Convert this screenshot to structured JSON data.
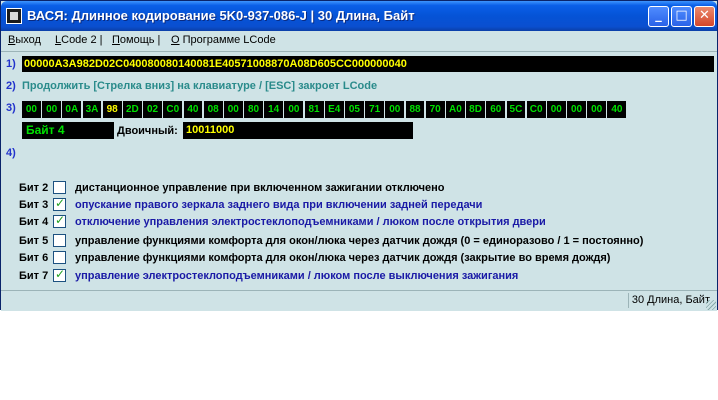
{
  "window": {
    "title": "ВАСЯ: Длинное кодирование  5K0-937-086-J  |  30 Длина, Байт",
    "minimize": "_",
    "maximize": "□",
    "close": "✕"
  },
  "menu": [
    {
      "label": "Выход"
    },
    {
      "label": "LCode 2 |"
    },
    {
      "label": "Помощь |"
    },
    {
      "label": "О Программе LCode"
    }
  ],
  "rows": {
    "r1": "1)",
    "r2": "2)",
    "r3": "3)",
    "r4": "4)"
  },
  "coding_string": "00000A3A982D02C040080080140081E40571008870A08D605CC000000040",
  "hint": "Продолжить [Стрелка вниз] на клавиатуре / [ESC] закроет LCode",
  "bytes": [
    "00",
    "00",
    "0A",
    "3A",
    "98",
    "2D",
    "02",
    "C0",
    "40",
    "08",
    "00",
    "80",
    "14",
    "00",
    "81",
    "E4",
    "05",
    "71",
    "00",
    "88",
    "70",
    "A0",
    "8D",
    "60",
    "5C",
    "C0",
    "00",
    "00",
    "00",
    "40"
  ],
  "selected_byte_index": 4,
  "byte_label": "Байт 4",
  "binary_label": "Двоичный:",
  "binary_value": "10011000",
  "bits": [
    {
      "label": "Бит 2",
      "checked": false,
      "desc": "дистанционное управление при включенном зажигании отключено"
    },
    {
      "label": "Бит 3",
      "checked": true,
      "desc": "опускание правого зеркала заднего вида при включении задней передачи"
    },
    {
      "label": "Бит 4",
      "checked": true,
      "desc": "отключение управления электростеклоподъемниками / люком после открытия двери"
    },
    {
      "label": "Бит 5",
      "checked": false,
      "desc": "управление функциями комфорта для окон/люка через датчик дождя (0 = единоразово / 1 = постоянно)"
    },
    {
      "label": "Бит 6",
      "checked": false,
      "desc": "управление функциями комфорта для окон/люка через датчик дождя (закрытие во время дождя)"
    },
    {
      "label": "Бит 7",
      "checked": true,
      "desc": "управление электростеклоподъемниками / люком после выключения зажигания"
    }
  ],
  "status": "30 Длина, Байт",
  "colors": {
    "window_bg": "#cfe3e6",
    "titlebar": "#0553d6",
    "field_bg": "#000000",
    "byte_text": "#00e000",
    "code_text": "#ffff00",
    "hint_text": "#2a8b8b",
    "checked_desc": "#1a1aa6"
  }
}
